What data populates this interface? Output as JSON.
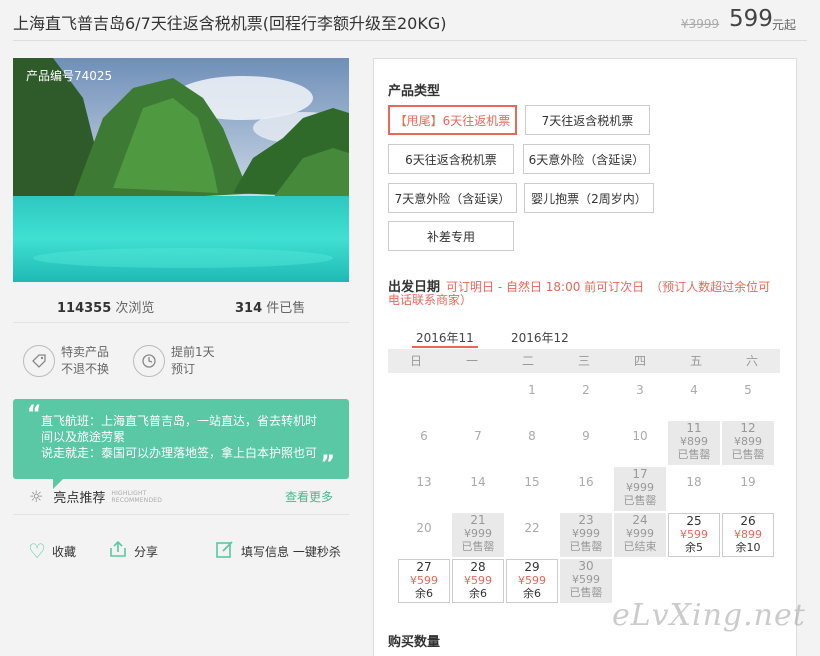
{
  "header": {
    "title": "上海直飞普吉岛6/7天往返含税机票(回程行李额升级至20KG)",
    "price_old": "¥3999",
    "price_now": "599",
    "price_unit": "元起"
  },
  "product": {
    "id_label": "产品编号74025",
    "views_count": "114355",
    "views_label": "次浏览",
    "sold_count": "314",
    "sold_label": "件已售"
  },
  "features": [
    {
      "icon": "tag-icon",
      "line1": "特卖产品",
      "line2": "不退不换"
    },
    {
      "icon": "clock-icon",
      "line1": "提前1天",
      "line2": "预订"
    }
  ],
  "quote": {
    "text": "直飞航班：上海直飞普吉岛，一站直达，省去转机时间以及旅途劳累\n说走就走：泰国可以办理落地签，拿上白本护照也可"
  },
  "highlight": {
    "title": "亮点推荐",
    "en": "HIGHLIGHT RECOMMENDED",
    "more": "查看更多"
  },
  "actions": [
    {
      "icon": "heart-icon",
      "label": "收藏"
    },
    {
      "icon": "share-icon",
      "label": "分享"
    },
    {
      "icon": "edit-icon",
      "label": "填写信息 一键秒杀"
    }
  ],
  "product_type": {
    "title": "产品类型",
    "options": [
      "【甩尾】6天往返机票",
      "7天往返含税机票",
      "6天往返含税机票",
      "6天意外险（含延误）",
      "7天意外险（含延误）",
      "婴儿抱票（2周岁内）",
      "补差专用"
    ]
  },
  "date": {
    "title": "出发日期",
    "note": "可订明日 - 自然日 18:00 前可订次日　（预订人数超过余位可电话联系商家）",
    "months": [
      "2016年11",
      "2016年12"
    ],
    "weekdays": [
      "日",
      "一",
      "二",
      "三",
      "四",
      "五",
      "六"
    ],
    "cells": [
      {
        "day": "1",
        "price": "",
        "status": "",
        "type": "plain"
      },
      {
        "day": "2",
        "price": "",
        "status": "",
        "type": "plain"
      },
      {
        "day": "3",
        "price": "",
        "status": "",
        "type": "plain"
      },
      {
        "day": "4",
        "price": "",
        "status": "",
        "type": "plain"
      },
      {
        "day": "5",
        "price": "",
        "status": "",
        "type": "plain"
      },
      {
        "day": "6",
        "price": "",
        "status": "",
        "type": "plain"
      },
      {
        "day": "7",
        "price": "",
        "status": "",
        "type": "plain"
      },
      {
        "day": "8",
        "price": "",
        "status": "",
        "type": "plain"
      },
      {
        "day": "9",
        "price": "",
        "status": "",
        "type": "plain"
      },
      {
        "day": "10",
        "price": "",
        "status": "",
        "type": "plain"
      },
      {
        "day": "11",
        "price": "¥899",
        "status": "已售罄",
        "type": "sold"
      },
      {
        "day": "12",
        "price": "¥899",
        "status": "已售罄",
        "type": "sold"
      },
      {
        "day": "13",
        "price": "",
        "status": "",
        "type": "plain"
      },
      {
        "day": "14",
        "price": "",
        "status": "",
        "type": "plain"
      },
      {
        "day": "15",
        "price": "",
        "status": "",
        "type": "plain"
      },
      {
        "day": "16",
        "price": "",
        "status": "",
        "type": "plain"
      },
      {
        "day": "17",
        "price": "¥999",
        "status": "已售罄",
        "type": "sold"
      },
      {
        "day": "18",
        "price": "",
        "status": "",
        "type": "plain"
      },
      {
        "day": "19",
        "price": "",
        "status": "",
        "type": "plain"
      },
      {
        "day": "20",
        "price": "",
        "status": "",
        "type": "plain"
      },
      {
        "day": "21",
        "price": "¥999",
        "status": "已售罄",
        "type": "sold"
      },
      {
        "day": "22",
        "price": "",
        "status": "",
        "type": "plain"
      },
      {
        "day": "23",
        "price": "¥999",
        "status": "已售罄",
        "type": "sold"
      },
      {
        "day": "24",
        "price": "¥999",
        "status": "已结束",
        "type": "sold"
      },
      {
        "day": "25",
        "price": "¥599",
        "status": "余5",
        "type": "avail"
      },
      {
        "day": "26",
        "price": "¥899",
        "status": "余10",
        "type": "avail"
      },
      {
        "day": "27",
        "price": "¥599",
        "status": "余6",
        "type": "avail"
      },
      {
        "day": "28",
        "price": "¥599",
        "status": "余6",
        "type": "avail"
      },
      {
        "day": "29",
        "price": "¥599",
        "status": "余6",
        "type": "avail"
      },
      {
        "day": "30",
        "price": "¥599",
        "status": "已售罄",
        "type": "sold"
      }
    ]
  },
  "quantity": {
    "title": "购买数量"
  },
  "watermark": "eLvXing.net"
}
